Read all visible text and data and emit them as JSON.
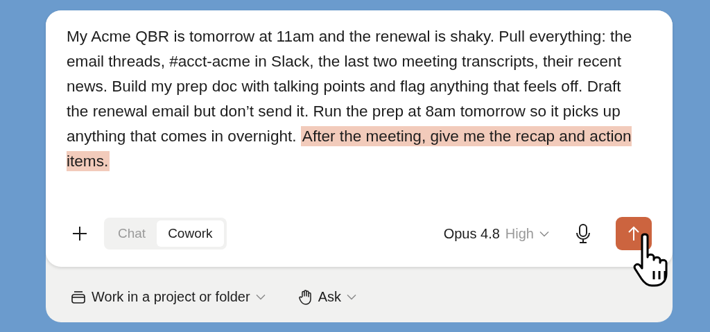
{
  "prompt": {
    "text": "My Acme QBR is tomorrow at 11am and the renewal is shaky. Pull everything: the email threads, #acct-acme in Slack, the last two meeting transcripts, their recent news. Build my prep doc with talking points and flag anything that feels off. Draft the renewal email but don’t send it. Run the prep at 8am tomorrow so it picks up anything that comes in overnight. ",
    "highlighted": "After the meeting, give me the recap and action items."
  },
  "modes": [
    {
      "label": "Chat",
      "selected": false
    },
    {
      "label": "Cowork",
      "selected": true
    }
  ],
  "model": {
    "name": "Opus 4.8",
    "effort": "High"
  },
  "footer": [
    {
      "kind": "project",
      "label": "Work in a project or folder"
    },
    {
      "kind": "ask",
      "label": "Ask"
    }
  ]
}
